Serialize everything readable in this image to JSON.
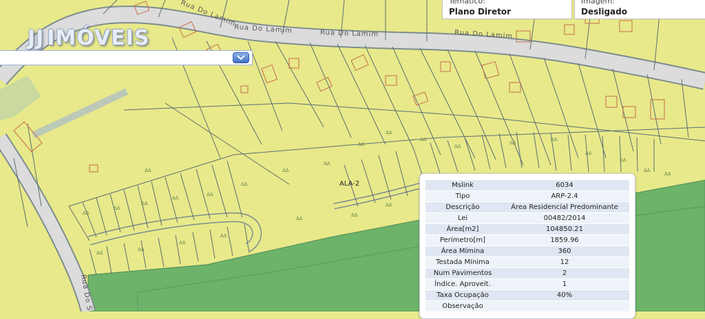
{
  "header": {
    "tematico_label": "Temático:",
    "tematico_value": "Plano Diretor",
    "imagem_label": "Imagem:",
    "imagem_value": "Desligado"
  },
  "logo": {
    "part1": "JJ",
    "part2": "IMÓVEIS"
  },
  "map": {
    "street_labels": [
      "Rua Do Lamim",
      "Rua Do Lamim",
      "Rua Do Lamim",
      "Rua Do Lamim",
      "Rua Do S"
    ],
    "zone_label": "ALA-2",
    "colors": {
      "zone_yellow": "#e8e98a",
      "protected_green": "#6db36a",
      "road": "#d8d8d8",
      "parcel_line": "#5c6e74",
      "building": "#c46d4a"
    }
  },
  "info_panel": {
    "rows": [
      {
        "key": "Mslink",
        "value": "6034"
      },
      {
        "key": "Tipo",
        "value": "ARP-2.4"
      },
      {
        "key": "Descrição",
        "value": "Área Residencial Predominante"
      },
      {
        "key": "Lei",
        "value": "00482/2014"
      },
      {
        "key": "Área[m2]",
        "value": "104850.21"
      },
      {
        "key": "Perímetro[m]",
        "value": "1859.96"
      },
      {
        "key": "Área Mímina",
        "value": "360"
      },
      {
        "key": "Testada Mínima",
        "value": "12"
      },
      {
        "key": "Num Pavimentos",
        "value": "2"
      },
      {
        "key": "Índice. Aproveit.",
        "value": "1"
      },
      {
        "key": "Taxa Ocupação",
        "value": "40%"
      },
      {
        "key": "Observação",
        "value": ""
      }
    ]
  }
}
